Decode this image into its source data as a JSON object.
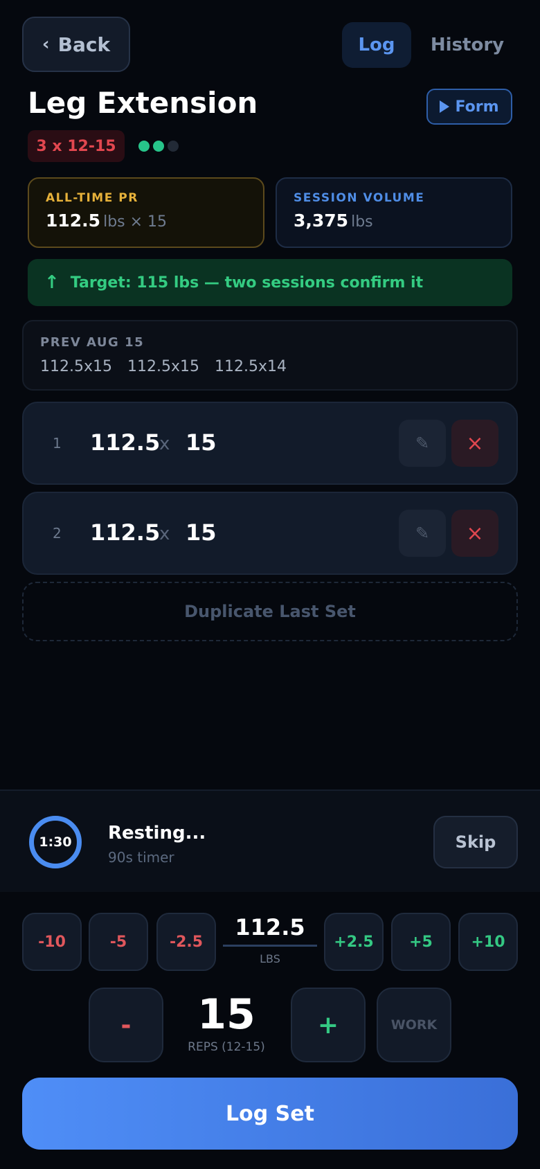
{
  "header": {
    "back_label": "Back",
    "tabs": [
      {
        "label": "Log",
        "active": true
      },
      {
        "label": "History",
        "active": false
      }
    ]
  },
  "exercise": {
    "title": "Leg Extension",
    "form_label": "Form",
    "scheme": "3 x 12-15",
    "progress_dots": {
      "filled": 2,
      "total": 3
    }
  },
  "stats": {
    "pr": {
      "label": "ALL-TIME PR",
      "value": "112.5",
      "unit": "lbs × 15"
    },
    "volume": {
      "label": "SESSION VOLUME",
      "value": "3,375",
      "unit": "lbs"
    }
  },
  "target": {
    "text": "Target: 115 lbs — two sessions confirm it"
  },
  "previous": {
    "label": "PREV AUG 15",
    "sets": [
      "112.5x15",
      "112.5x15",
      "112.5x14"
    ]
  },
  "sets": [
    {
      "num": "1",
      "weight": "112.5",
      "x": "x",
      "reps": "15"
    },
    {
      "num": "2",
      "weight": "112.5",
      "x": "x",
      "reps": "15"
    }
  ],
  "duplicate_label": "Duplicate Last Set",
  "rest": {
    "timer": "1:30",
    "title": "Resting...",
    "subtitle": "90s timer",
    "skip_label": "Skip"
  },
  "controls": {
    "weight_steps_neg": [
      "-10",
      "-5",
      "-2.5"
    ],
    "weight_steps_pos": [
      "+2.5",
      "+5",
      "+10"
    ],
    "weight_value": "112.5",
    "weight_unit": "LBS",
    "reps_minus": "-",
    "reps_plus": "+",
    "reps_value": "15",
    "reps_label": "REPS (12-15)",
    "set_type": "WORK",
    "log_label": "Log Set"
  },
  "colors": {
    "accent_blue": "#4f8ef7",
    "pr_gold": "#e6b13a",
    "success_green": "#34cc82",
    "danger_red": "#e0474f"
  }
}
